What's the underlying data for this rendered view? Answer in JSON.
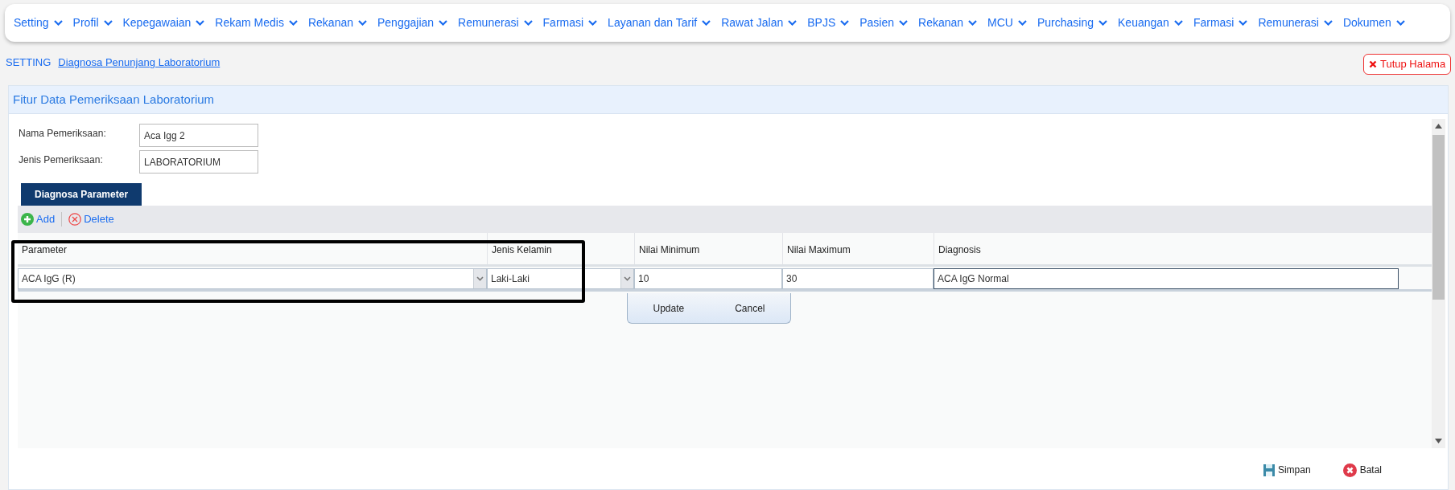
{
  "nav": [
    {
      "label": "Setting"
    },
    {
      "label": "Profil"
    },
    {
      "label": "Kepegawaian"
    },
    {
      "label": "Rekam Medis"
    },
    {
      "label": "Rekanan"
    },
    {
      "label": "Penggajian"
    },
    {
      "label": "Remunerasi"
    },
    {
      "label": "Farmasi"
    },
    {
      "label": "Layanan dan Tarif"
    },
    {
      "label": "Rawat Jalan"
    },
    {
      "label": "BPJS"
    },
    {
      "label": "Pasien"
    },
    {
      "label": "Rekanan"
    },
    {
      "label": "MCU"
    },
    {
      "label": "Purchasing"
    },
    {
      "label": "Keuangan"
    },
    {
      "label": "Farmasi"
    },
    {
      "label": "Remunerasi"
    },
    {
      "label": "Dokumen"
    }
  ],
  "breadcrumb": {
    "section": "SETTING",
    "page": "Diagnosa Penunjang Laboratorium"
  },
  "close_button": "Tutup Halama",
  "panel": {
    "title": "Fitur Data Pemeriksaan Laboratorium",
    "fields": [
      {
        "label": "Nama Pemeriksaan:",
        "value": "Aca Igg 2"
      },
      {
        "label": "Jenis Pemeriksaan:",
        "value": "LABORATORIUM"
      }
    ],
    "tabs": [
      {
        "label": "Diagnosa Parameter",
        "selected": true
      }
    ],
    "toolbar": [
      {
        "kind": "add",
        "label": "Add"
      },
      {
        "kind": "delete",
        "label": "Delete"
      }
    ],
    "columns": [
      "Parameter",
      "Jenis Kelamin",
      "Nilai Minimum",
      "Nilai Maximum",
      "Diagnosis"
    ],
    "edit_row": [
      {
        "kind": "select",
        "value": "ACA IgG (R)",
        "focused": false
      },
      {
        "kind": "select",
        "value": "Laki-Laki",
        "focused": false
      },
      {
        "kind": "input",
        "value": "10",
        "focused": false
      },
      {
        "kind": "input",
        "value": "30",
        "focused": false
      },
      {
        "kind": "input",
        "value": "ACA IgG Normal",
        "focused": true
      }
    ],
    "row_buttons": [
      "Update",
      "Cancel"
    ],
    "footer": [
      {
        "kind": "save",
        "label": "Simpan"
      },
      {
        "kind": "cancel",
        "label": "Batal"
      }
    ]
  }
}
